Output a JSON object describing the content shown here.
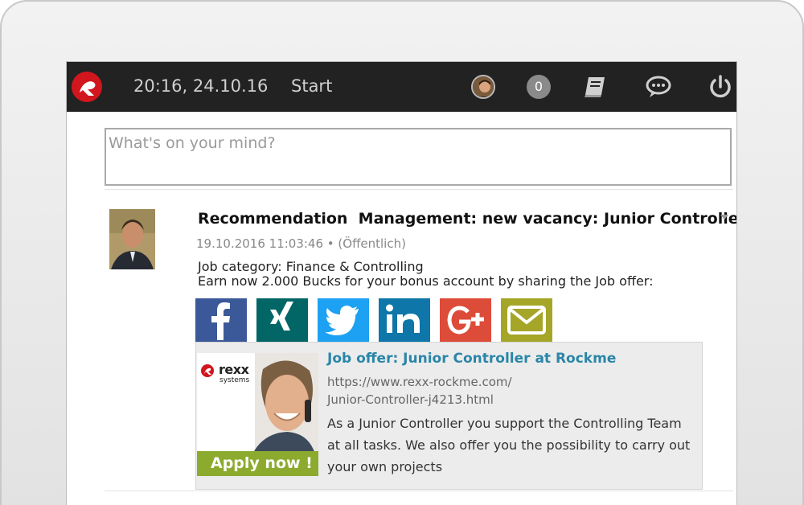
{
  "topbar": {
    "datetime": "20:16, 24.10.16",
    "start_label": "Start",
    "notification_count": "0"
  },
  "composer": {
    "placeholder": "What's on your mind?"
  },
  "post": {
    "title": "Recommendation  Management: new vacancy: Junior Controller",
    "meta": "19.10.2016 11:03:46 • (Öffentlich)",
    "line1": "Job category: Finance & Controlling",
    "line2": "Earn now 2.000 Bucks for your bonus account by sharing the Job offer:",
    "share_buttons": [
      {
        "name": "facebook",
        "color": "#3b5998"
      },
      {
        "name": "xing",
        "color": "#036666"
      },
      {
        "name": "twitter",
        "color": "#1da1f2"
      },
      {
        "name": "linkedin",
        "color": "#0e76a8"
      },
      {
        "name": "google-plus",
        "color": "#dd4b39"
      },
      {
        "name": "email",
        "color": "#a5a528"
      }
    ]
  },
  "card": {
    "brand": "rexx",
    "brand_sub": "systems",
    "apply_label": "Apply now !",
    "title": "Job offer: Junior Controller at Rockme",
    "url_line1": "https://www.rexx-rockme.com/",
    "url_line2": "Junior-Controller-j4213.html",
    "description": "As a Junior Controller you support the Controlling Team at all tasks. We also offer you the possibility to carry out your own projects"
  }
}
